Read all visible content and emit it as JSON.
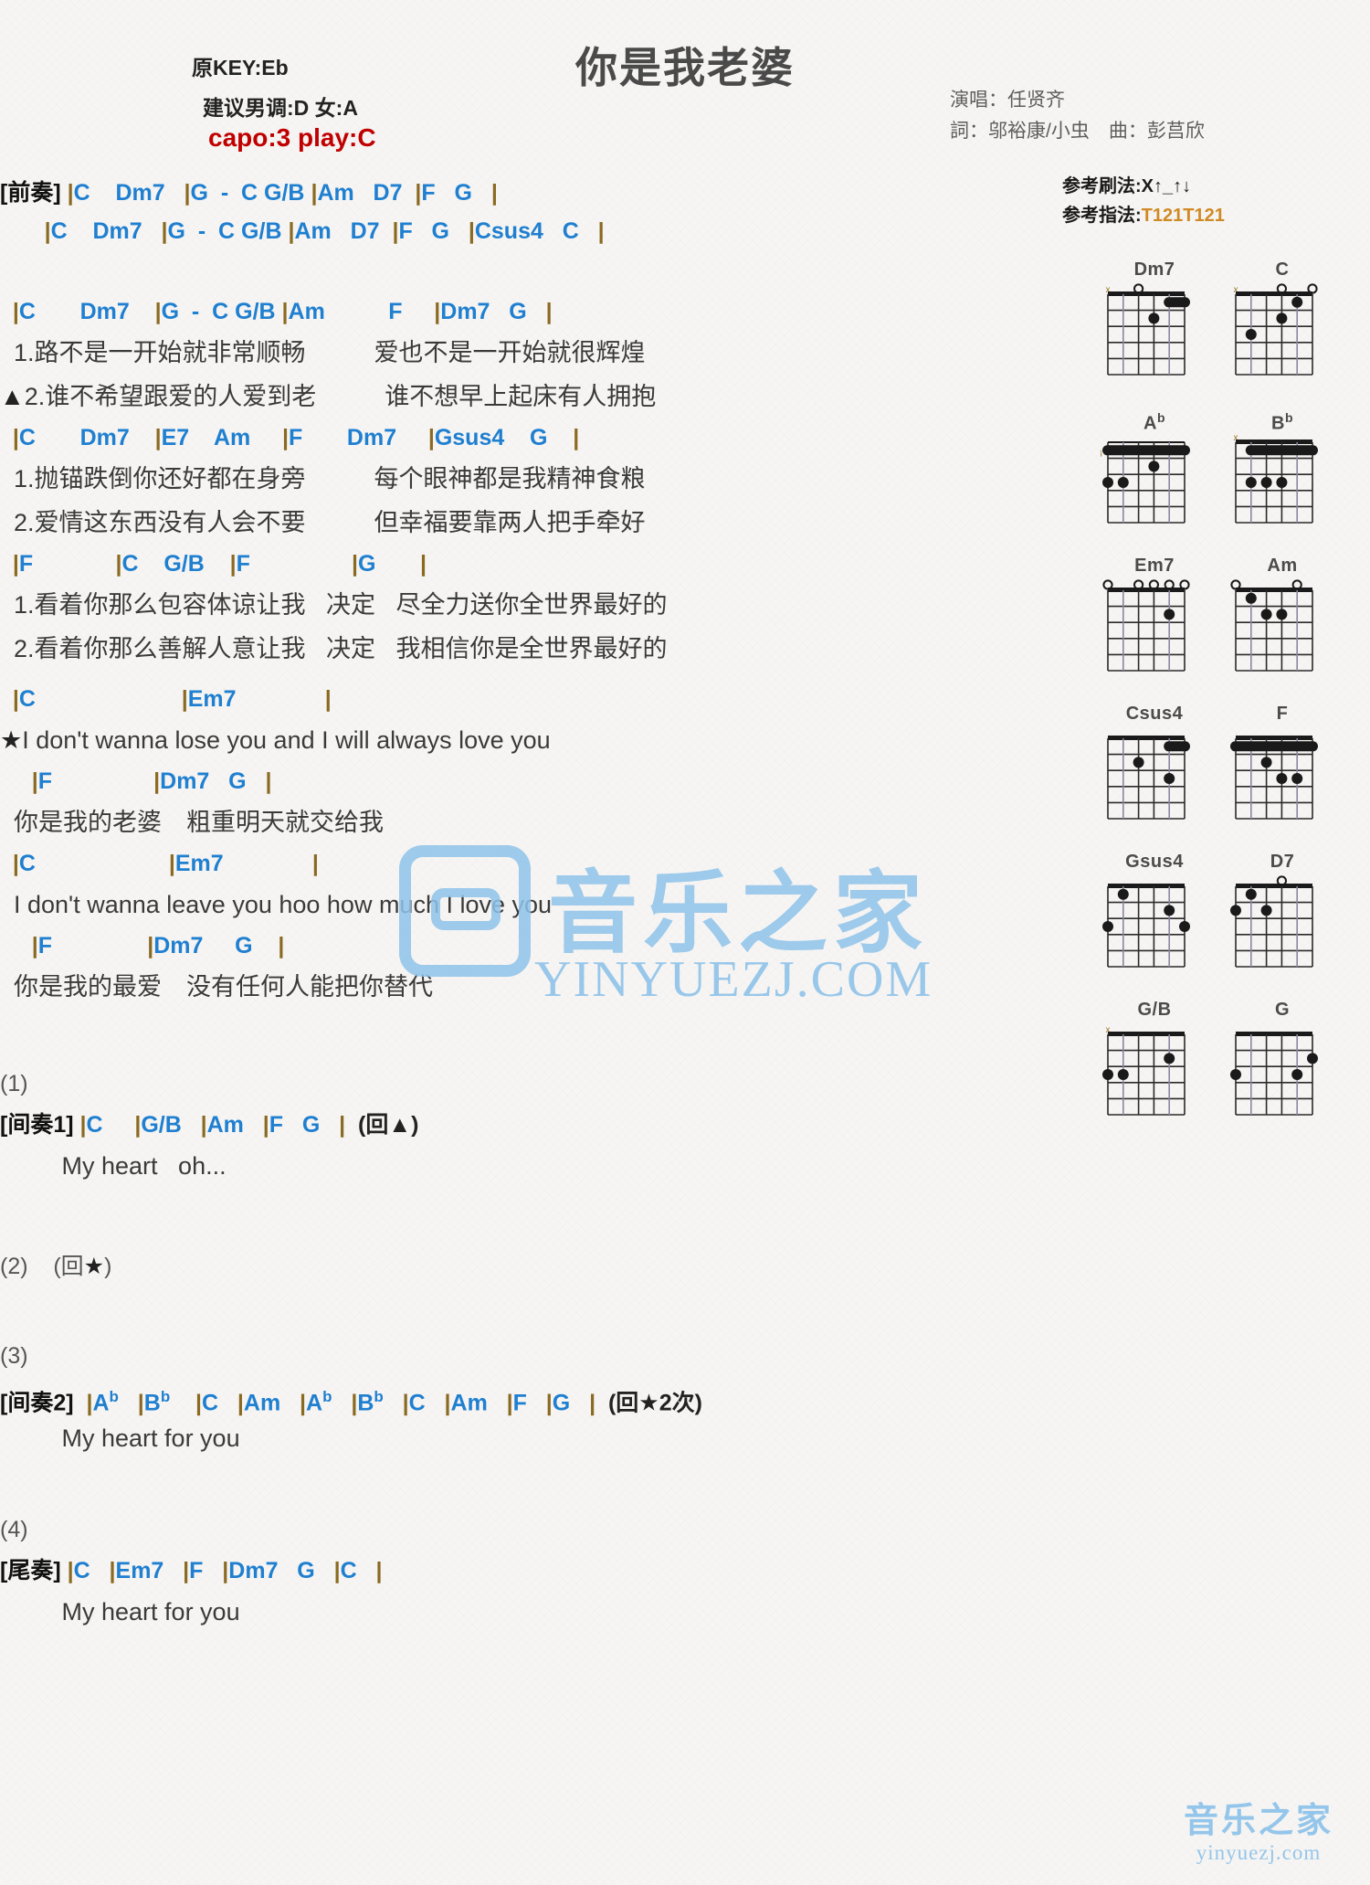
{
  "header": {
    "orig_key": "原KEY:Eb",
    "suggest_key": "建议男调:D 女:A",
    "capo": "capo:3 play:C",
    "title": "你是我老婆",
    "singer": "演唱：任贤齐",
    "writer": "詞：邬裕康/小虫　曲：彭莒欣",
    "strum_label": "参考刷法:X",
    "strum_pattern": "↑_↑↓",
    "fingering_label": "参考指法:",
    "fingering_pattern": "T121T121"
  },
  "sections": [
    {
      "label": "[前奏]",
      "lines": [
        {
          "type": "chord",
          "text": "[前奏] |C    Dm7   |G  -  C G/B |Am   D7  |F   G   |"
        },
        {
          "type": "chord",
          "text": "       |C    Dm7   |G  -  C G/B |Am   D7  |F   G   |Csus4   C   |"
        }
      ]
    },
    {
      "label": "verse1",
      "lines": [
        {
          "type": "chord",
          "text": "  |C       Dm7    |G  -  C G/B |Am          F     |Dm7   G   |"
        },
        {
          "type": "lyric",
          "text": "  1.路不是一开始就非常顺畅          爱也不是一开始就很辉煌"
        },
        {
          "type": "lyric",
          "text": "▲2.谁不希望跟爱的人爱到老          谁不想早上起床有人拥抱"
        },
        {
          "type": "chord",
          "text": "  |C       Dm7    |E7    Am     |F       Dm7     |Gsus4    G    |"
        },
        {
          "type": "lyric",
          "text": "  1.抛锚跌倒你还好都在身旁          每个眼神都是我精神食粮"
        },
        {
          "type": "lyric",
          "text": "  2.爱情这东西没有人会不要          但幸福要靠两人把手牵好"
        },
        {
          "type": "chord",
          "text": "  |F             |C    G/B    |F                |G       |"
        },
        {
          "type": "lyric",
          "text": "  1.看着你那么包容体谅让我   决定   尽全力送你全世界最好的"
        },
        {
          "type": "lyric",
          "text": "  2.看着你那么善解人意让我   决定   我相信你是全世界最好的"
        }
      ]
    },
    {
      "label": "chorus",
      "lines": [
        {
          "type": "chord",
          "text": "  |C                       |Em7              |"
        },
        {
          "type": "lyric",
          "text": "★I don't wanna lose you and I will always love you"
        },
        {
          "type": "chord",
          "text": "     |F                |Dm7   G   |"
        },
        {
          "type": "lyric",
          "text": "  你是我的老婆　粗重明天就交给我"
        },
        {
          "type": "chord",
          "text": "  |C                     |Em7              |"
        },
        {
          "type": "lyric",
          "text": "  I don't wanna leave you hoo how much I love you"
        },
        {
          "type": "chord",
          "text": "     |F               |Dm7     G    |"
        },
        {
          "type": "lyric",
          "text": "  你是我的最爱　没有任何人能把你替代"
        }
      ]
    },
    {
      "label": "interlude1",
      "lines": [
        {
          "type": "num",
          "text": "(1)"
        },
        {
          "type": "chord",
          "text": "[间奏1] |C     |G/B   |Am   |F   G   |  (回▲)"
        },
        {
          "type": "lyric",
          "text": "         My heart   oh..."
        }
      ]
    },
    {
      "label": "repeat2",
      "lines": [
        {
          "type": "num",
          "text": "(2)    (回★)"
        }
      ]
    },
    {
      "label": "interlude2",
      "lines": [
        {
          "type": "num",
          "text": "(3)"
        },
        {
          "type": "chord",
          "text": "[间奏2]  |Ab   |Bb    |C   |Am   |Ab   |Bb   |C   |Am   |F   |G   |  (回★2次)"
        },
        {
          "type": "lyric",
          "text": "         My heart for you"
        }
      ]
    },
    {
      "label": "outro",
      "lines": [
        {
          "type": "num",
          "text": "(4)"
        },
        {
          "type": "chord",
          "text": "[尾奏] |C   |Em7   |F   |Dm7   G   |C   |"
        },
        {
          "type": "lyric",
          "text": "         My heart for you"
        }
      ]
    }
  ],
  "chord_diagrams": [
    {
      "name": "Dm7",
      "base_fret": "",
      "markers": [
        "x",
        "",
        "o",
        "",
        "",
        ""
      ],
      "barre": {
        "from": 4,
        "to": 5,
        "fret": 1
      },
      "dots": [
        {
          "string": 3,
          "fret": 2
        }
      ]
    },
    {
      "name": "C",
      "base_fret": "",
      "markers": [
        "x",
        "",
        "",
        "o",
        "",
        "o"
      ],
      "barre": null,
      "dots": [
        {
          "string": 4,
          "fret": 1
        },
        {
          "string": 3,
          "fret": 2
        },
        {
          "string": 1,
          "fret": 3
        }
      ]
    },
    {
      "name": "Ab",
      "base_fret": "4",
      "markers": [
        "",
        "",
        "",
        "",
        "",
        ""
      ],
      "barre": {
        "from": 0,
        "to": 5,
        "fret": 1
      },
      "dots": [
        {
          "string": 3,
          "fret": 2
        },
        {
          "string": 0,
          "fret": 3
        },
        {
          "string": 1,
          "fret": 3
        }
      ]
    },
    {
      "name": "Bb",
      "base_fret": "",
      "markers": [
        "x",
        "",
        "",
        "",
        "",
        ""
      ],
      "barre": {
        "from": 1,
        "to": 5,
        "fret": 1
      },
      "dots": [
        {
          "string": 1,
          "fret": 3
        },
        {
          "string": 2,
          "fret": 3
        },
        {
          "string": 3,
          "fret": 3
        }
      ]
    },
    {
      "name": "Em7",
      "base_fret": "",
      "markers": [
        "o",
        "",
        "o",
        "o",
        "o",
        "o"
      ],
      "barre": null,
      "dots": [
        {
          "string": 4,
          "fret": 2
        }
      ]
    },
    {
      "name": "Am",
      "base_fret": "",
      "markers": [
        "o",
        "",
        "",
        "",
        "o",
        ""
      ],
      "barre": null,
      "dots": [
        {
          "string": 1,
          "fret": 1
        },
        {
          "string": 2,
          "fret": 2
        },
        {
          "string": 3,
          "fret": 2
        }
      ]
    },
    {
      "name": "Csus4",
      "base_fret": "",
      "markers": [
        "",
        "",
        "",
        "",
        "",
        ""
      ],
      "barre": {
        "from": 4,
        "to": 5,
        "fret": 1
      },
      "dots": [
        {
          "string": 2,
          "fret": 2
        },
        {
          "string": 4,
          "fret": 3
        }
      ]
    },
    {
      "name": "F",
      "base_fret": "",
      "markers": [
        "",
        "",
        "",
        "",
        "",
        ""
      ],
      "barre": {
        "from": 0,
        "to": 5,
        "fret": 1
      },
      "dots": [
        {
          "string": 2,
          "fret": 2
        },
        {
          "string": 3,
          "fret": 3
        },
        {
          "string": 4,
          "fret": 3
        }
      ]
    },
    {
      "name": "Gsus4",
      "base_fret": "",
      "markers": [
        "",
        "",
        "",
        "",
        "",
        ""
      ],
      "barre": null,
      "dots": [
        {
          "string": 1,
          "fret": 1
        },
        {
          "string": 4,
          "fret": 2
        },
        {
          "string": 0,
          "fret": 3
        },
        {
          "string": 5,
          "fret": 3
        }
      ]
    },
    {
      "name": "D7",
      "base_fret": "",
      "markers": [
        "",
        "",
        "",
        "o",
        "",
        ""
      ],
      "barre": null,
      "dots": [
        {
          "string": 1,
          "fret": 1
        },
        {
          "string": 2,
          "fret": 2
        },
        {
          "string": 0,
          "fret": 2
        }
      ]
    },
    {
      "name": "G/B",
      "base_fret": "",
      "markers": [
        "x",
        "",
        "",
        "",
        "",
        ""
      ],
      "barre": null,
      "dots": [
        {
          "string": 4,
          "fret": 2
        },
        {
          "string": 1,
          "fret": 3
        },
        {
          "string": 0,
          "fret": 3
        }
      ]
    },
    {
      "name": "G",
      "base_fret": "",
      "markers": [
        "",
        "",
        "",
        "",
        "",
        ""
      ],
      "barre": null,
      "dots": [
        {
          "string": 5,
          "fret": 2
        },
        {
          "string": 4,
          "fret": 3
        },
        {
          "string": 0,
          "fret": 3
        }
      ]
    }
  ],
  "watermark": {
    "cn": "音乐之家",
    "en": "YINYUEZJ.COM",
    "corner_cn": "音乐之家",
    "corner_en": "yinyuezj.com"
  }
}
